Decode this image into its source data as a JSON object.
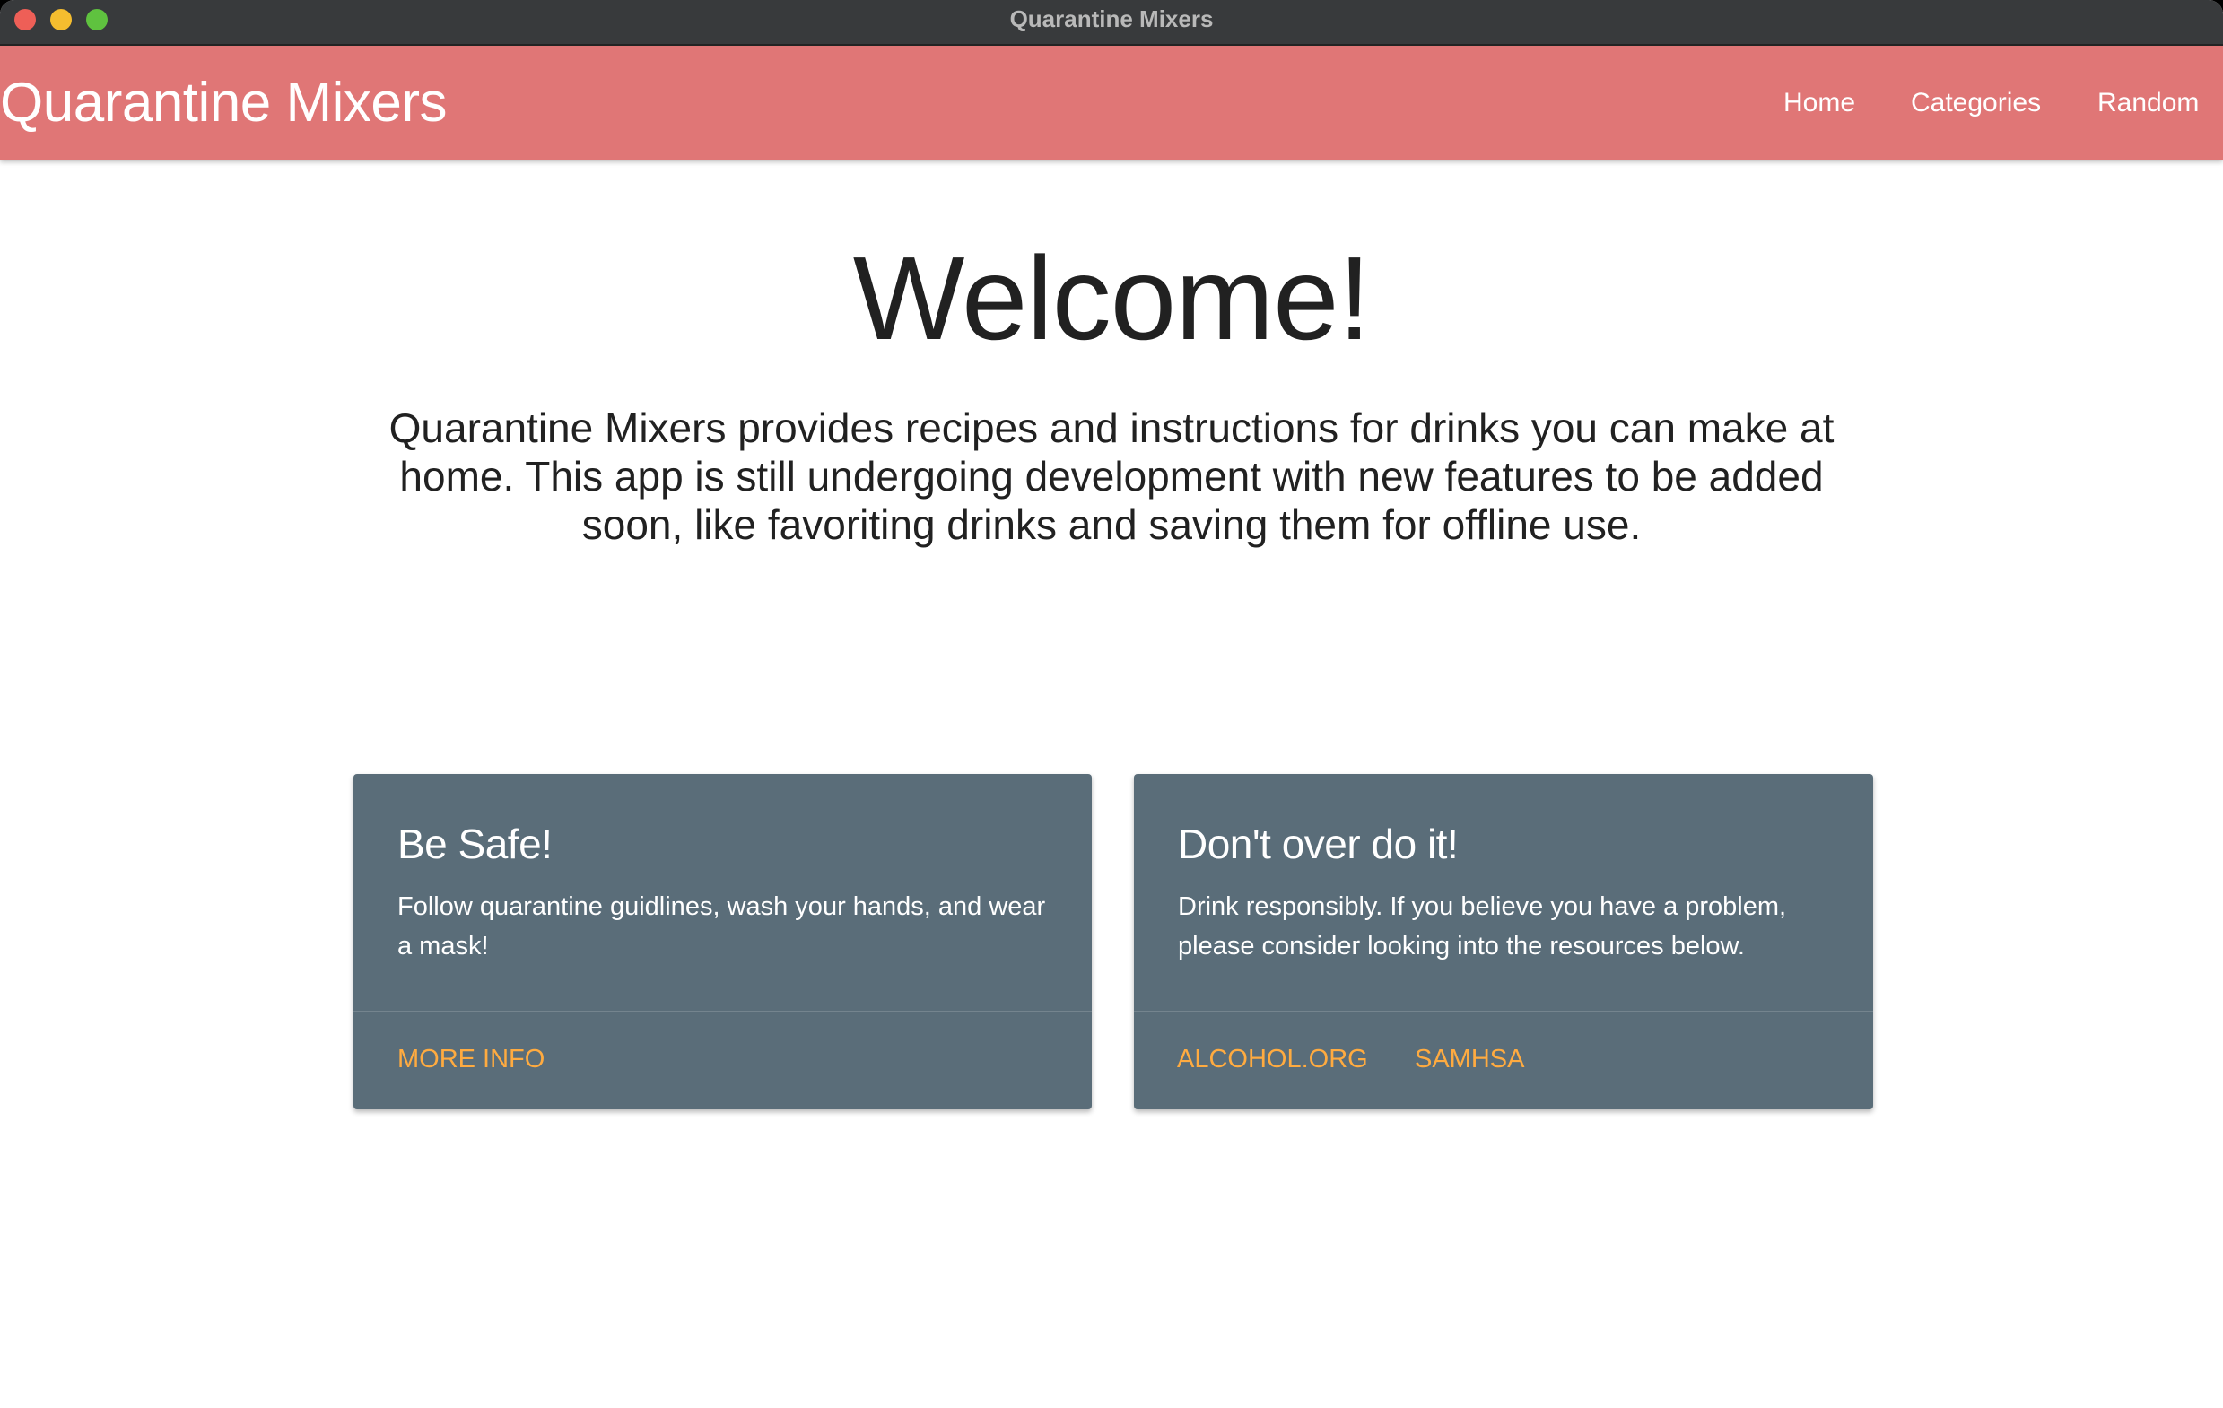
{
  "window": {
    "title": "Quarantine Mixers"
  },
  "navbar": {
    "brand": "Quarantine Mixers",
    "links": [
      "Home",
      "Categories",
      "Random"
    ]
  },
  "main": {
    "heading": "Welcome!",
    "intro": "Quarantine Mixers provides recipes and instructions for drinks you can make at home. This app is still undergoing development with new features to be added soon, like favoriting drinks and saving them for offline use."
  },
  "cards": [
    {
      "title": "Be Safe!",
      "text": "Follow quarantine guidlines, wash your hands, and wear a mask!",
      "links": [
        "MORE INFO"
      ]
    },
    {
      "title": "Don't over do it!",
      "text": "Drink responsibly. If you believe you have a problem, please consider looking into the resources below.",
      "links": [
        "ALCOHOL.ORG",
        "SAMHSA"
      ]
    }
  ],
  "colors": {
    "navbar": "#e07676",
    "card": "#5a6d79",
    "card_link": "#ffab40",
    "titlebar": "#383a3c"
  }
}
